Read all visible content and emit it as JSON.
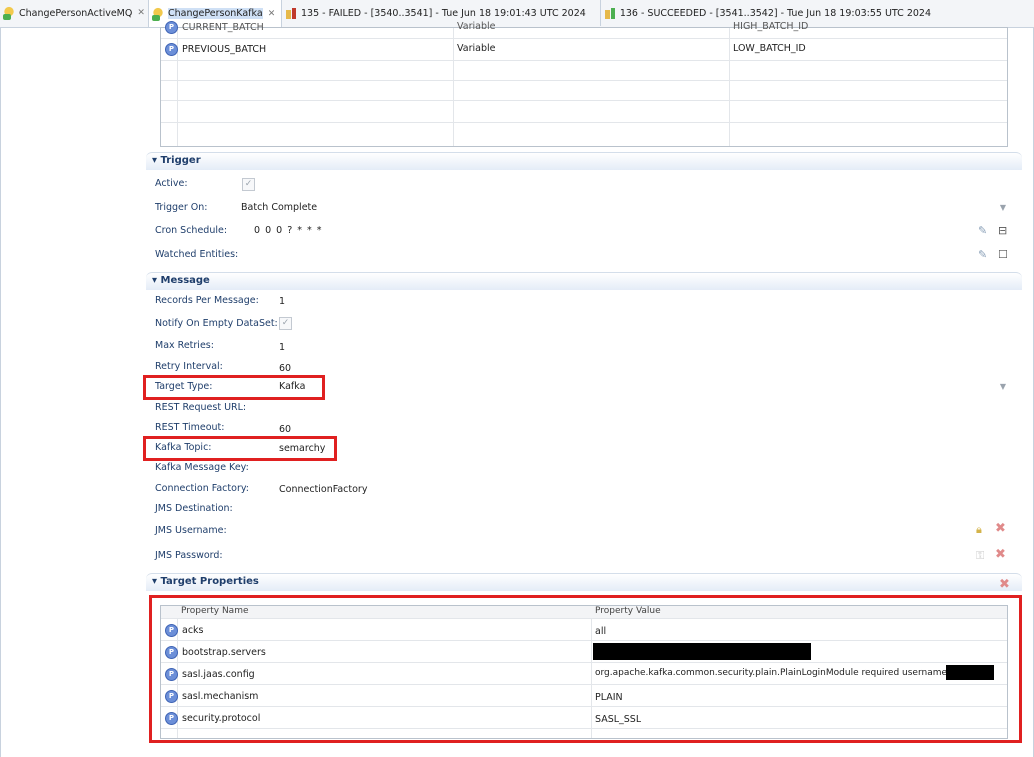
{
  "tabs": [
    {
      "label": "ChangePersonActiveMQ",
      "icon": "element-icon",
      "active": false
    },
    {
      "label": "ChangePersonKafka",
      "icon": "element-icon",
      "active": true
    },
    {
      "label": "135 - FAILED - [3540..3541] - Tue Jun 18 19:01:43 UTC 2024",
      "icon": "job-failed-icon",
      "active": false
    },
    {
      "label": "136 - SUCCEEDED - [3541..3542] - Tue Jun 18 19:03:55 UTC 2024",
      "icon": "job-succeeded-icon",
      "active": false
    }
  ],
  "variables_grid": {
    "rows": [
      {
        "name": "CURRENT_BATCH",
        "type": "Variable",
        "value": "HIGH_BATCH_ID"
      },
      {
        "name": "PREVIOUS_BATCH",
        "type": "Variable",
        "value": "LOW_BATCH_ID"
      }
    ]
  },
  "trigger": {
    "title": "Trigger",
    "active_label": "Active:",
    "active_checked": true,
    "trigger_on_label": "Trigger On:",
    "trigger_on_value": "Batch Complete",
    "cron_label": "Cron Schedule:",
    "cron_value": "0 0 0 ? * * *",
    "watched_label": "Watched Entities:"
  },
  "message": {
    "title": "Message",
    "records_label": "Records Per Message:",
    "records_value": "1",
    "notify_label": "Notify On Empty DataSet:",
    "notify_checked": true,
    "max_retries_label": "Max Retries:",
    "max_retries_value": "1",
    "retry_interval_label": "Retry Interval:",
    "retry_interval_value": "60",
    "target_type_label": "Target Type:",
    "target_type_value": "Kafka",
    "rest_url_label": "REST Request URL:",
    "rest_timeout_label": "REST Timeout:",
    "rest_timeout_value": "60",
    "kafka_topic_label": "Kafka Topic:",
    "kafka_topic_value": "semarchy",
    "kafka_key_label": "Kafka Message Key:",
    "conn_factory_label": "Connection Factory:",
    "conn_factory_value": "ConnectionFactory",
    "jms_dest_label": "JMS Destination:",
    "jms_user_label": "JMS Username:",
    "jms_pass_label": "JMS Password:"
  },
  "target_properties": {
    "title": "Target Properties",
    "col_name": "Property Name",
    "col_value": "Property Value",
    "rows": [
      {
        "name": "acks",
        "value": "all"
      },
      {
        "name": "bootstrap.servers",
        "value": ""
      },
      {
        "name": "sasl.jaas.config",
        "value": "org.apache.kafka.common.security.plain.PlainLoginModule required username="
      },
      {
        "name": "sasl.mechanism",
        "value": "PLAIN"
      },
      {
        "name": "security.protocol",
        "value": "SASL_SSL"
      }
    ]
  },
  "colors": {
    "highlight": "#e02020",
    "section_title": "#1f3e6b",
    "label": "#1f3e6b"
  }
}
